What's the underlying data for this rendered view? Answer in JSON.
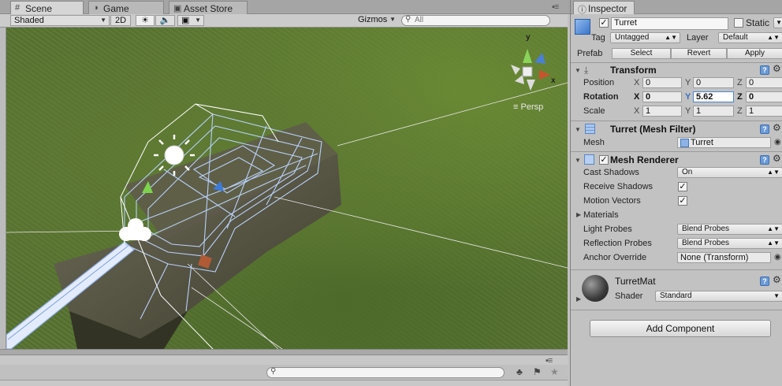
{
  "tabs": {
    "scene": "Scene",
    "game": "Game",
    "asset_store": "Asset Store",
    "inspector": "Inspector"
  },
  "scene_toolbar": {
    "shading_mode": "Shaded",
    "mode_2d": "2D",
    "gizmos": "Gizmos",
    "search_placeholder": "All"
  },
  "viewport": {
    "projection_label": "Persp",
    "gizmo_axes": {
      "y": "y",
      "x": "x"
    }
  },
  "inspector": {
    "object_name": "Turret",
    "active": true,
    "static_label": "Static",
    "static": false,
    "tag_label": "Tag",
    "tag_value": "Untagged",
    "layer_label": "Layer",
    "layer_value": "Default",
    "prefab_label": "Prefab",
    "prefab_buttons": {
      "select": "Select",
      "revert": "Revert",
      "apply": "Apply"
    },
    "transform": {
      "title": "Transform",
      "rows": [
        {
          "label": "Position",
          "x": "0",
          "y": "0",
          "z": "0"
        },
        {
          "label": "Rotation",
          "x": "0",
          "y": "5.62",
          "z": "0"
        },
        {
          "label": "Scale",
          "x": "1",
          "y": "1",
          "z": "1"
        }
      ],
      "axis_labels": {
        "x": "X",
        "y": "Y",
        "z": "Z"
      }
    },
    "mesh_filter": {
      "title": "Turret (Mesh Filter)",
      "mesh_label": "Mesh",
      "mesh_value": "Turret"
    },
    "mesh_renderer": {
      "title": "Mesh Renderer",
      "enabled": true,
      "cast_shadows_label": "Cast Shadows",
      "cast_shadows_value": "On",
      "receive_shadows_label": "Receive Shadows",
      "receive_shadows": true,
      "motion_vectors_label": "Motion Vectors",
      "motion_vectors": true,
      "materials_label": "Materials",
      "light_probes_label": "Light Probes",
      "light_probes_value": "Blend Probes",
      "reflection_probes_label": "Reflection Probes",
      "reflection_probes_value": "Blend Probes",
      "anchor_override_label": "Anchor Override",
      "anchor_override_value": "None (Transform)"
    },
    "material": {
      "name": "TurretMat",
      "shader_label": "Shader",
      "shader_value": "Standard"
    },
    "add_component": "Add Component"
  },
  "colors": {
    "panel_bg": "#c2c2c2",
    "accent_focus": "#4a86d4",
    "wireframe": "#a9c4f2",
    "grass": "#587431"
  }
}
